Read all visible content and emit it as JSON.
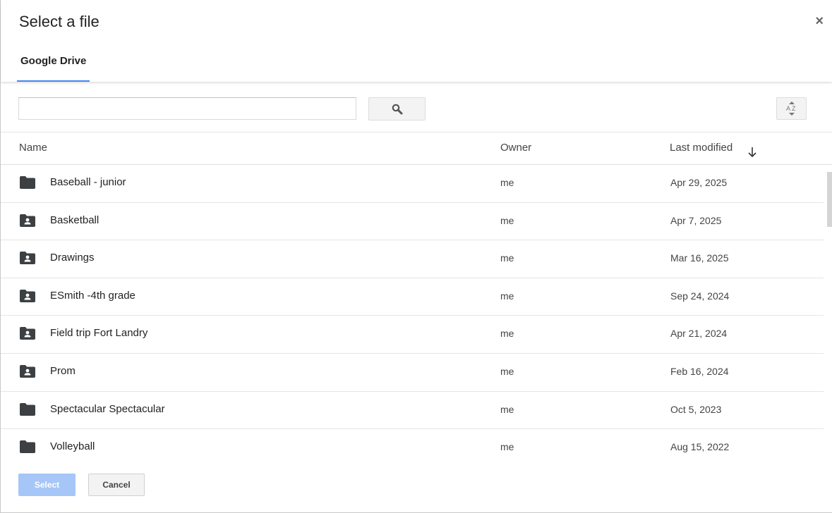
{
  "dialog": {
    "title": "Select a file",
    "close_label": "×",
    "tab_label": "Google Drive"
  },
  "toolbar": {
    "search_value": "",
    "search_placeholder": "",
    "search_icon": "magnifier-icon",
    "sort_icon": "sort-az-icon"
  },
  "columns": {
    "name": "Name",
    "owner": "Owner",
    "last_modified": "Last modified",
    "sort_direction": "descending"
  },
  "files": [
    {
      "name": "Baseball - junior",
      "owner": "me",
      "modified": "Apr 29, 2025",
      "icon": "folder"
    },
    {
      "name": "Basketball",
      "owner": "me",
      "modified": "Apr 7, 2025",
      "icon": "shared-folder"
    },
    {
      "name": "Drawings",
      "owner": "me",
      "modified": "Mar 16, 2025",
      "icon": "shared-folder"
    },
    {
      "name": "ESmith -4th grade",
      "owner": "me",
      "modified": "Sep 24, 2024",
      "icon": "shared-folder"
    },
    {
      "name": "Field trip Fort Landry",
      "owner": "me",
      "modified": "Apr 21, 2024",
      "icon": "shared-folder"
    },
    {
      "name": "Prom",
      "owner": "me",
      "modified": "Feb 16, 2024",
      "icon": "shared-folder"
    },
    {
      "name": "Spectacular Spectacular",
      "owner": "me",
      "modified": "Oct 5, 2023",
      "icon": "folder"
    },
    {
      "name": "Volleyball",
      "owner": "me",
      "modified": "Aug 15, 2022",
      "icon": "folder"
    }
  ],
  "footer": {
    "select_label": "Select",
    "cancel_label": "Cancel"
  },
  "colors": {
    "accent": "#4285f4",
    "select_disabled": "#a7c6f8",
    "folder": "#3c4043"
  }
}
